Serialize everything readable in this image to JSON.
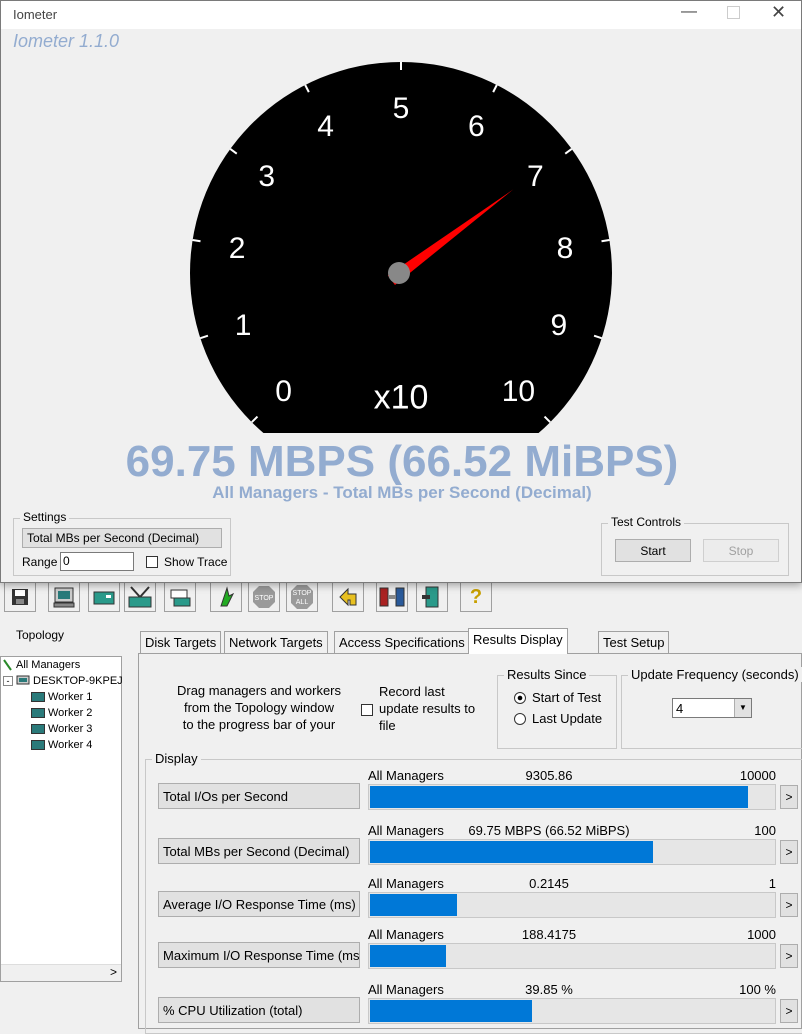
{
  "meter": {
    "window_title": "Iometer",
    "watermark": "Iometer 1.1.0",
    "gauge_labels": [
      "0",
      "1",
      "2",
      "3",
      "4",
      "5",
      "6",
      "7",
      "8",
      "9",
      "10"
    ],
    "gauge_multiplier": "x10",
    "needle_value": 6.975,
    "readout": "69.75 MBPS (66.52 MiBPS)",
    "subtitle": "All Managers - Total MBs per Second (Decimal)",
    "settings": {
      "label": "Settings",
      "metric_button": "Total MBs per Second (Decimal)",
      "range_label": "Range",
      "range_value": "0",
      "show_trace_label": "Show Trace"
    },
    "test_controls": {
      "label": "Test Controls",
      "start": "Start",
      "stop": "Stop"
    },
    "colors": {
      "gauge": "#000000",
      "needle": "#ff0000",
      "readout": "#93acd0"
    }
  },
  "topology": {
    "title": "Topology",
    "items": [
      {
        "label": "All Managers"
      },
      {
        "label": "DESKTOP-9KPEJ"
      },
      {
        "label": "Worker 1"
      },
      {
        "label": "Worker 2"
      },
      {
        "label": "Worker 3"
      },
      {
        "label": "Worker 4"
      }
    ],
    "scroll_left": "<",
    "scroll_right": ">"
  },
  "tabs": [
    "Disk Targets",
    "Network Targets",
    "Access Specifications",
    "Results Display",
    "Test Setup"
  ],
  "results": {
    "drag_text_1": "Drag managers and workers",
    "drag_text_2": "from the Topology window",
    "drag_text_3": "to the progress bar of your",
    "record_label_1": "Record last",
    "record_label_2": "update results to",
    "record_label_3": "file",
    "results_since": {
      "label": "Results Since",
      "option1": "Start of Test",
      "option2": "Last Update"
    },
    "update_frequency": {
      "label": "Update Frequency (seconds)",
      "value": "4"
    },
    "display_label": "Display",
    "rows": [
      {
        "button": "Total I/Os per Second",
        "manager": "All Managers",
        "value": "9305.86",
        "max": "10000",
        "fraction": 0.93
      },
      {
        "button": "Total MBs per Second (Decimal)",
        "manager": "All Managers",
        "value": "69.75 MBPS (66.52 MiBPS)",
        "max": "100",
        "fraction": 0.6975
      },
      {
        "button": "Average I/O Response Time (ms)",
        "manager": "All Managers",
        "value": "0.2145",
        "max": "1",
        "fraction": 0.2145
      },
      {
        "button": "Maximum I/O Response Time (ms",
        "manager": "All Managers",
        "value": "188.4175",
        "max": "1000",
        "fraction": 0.188
      },
      {
        "button": "% CPU Utilization (total)",
        "manager": "All Managers",
        "value": "39.85 %",
        "max": "100 %",
        "fraction": 0.3985
      }
    ],
    "arrow": ">"
  },
  "toolbar": {
    "stop_label": "STOP",
    "stop_all_label_1": "STOP",
    "stop_all_label_2": "ALL",
    "help_label": "?"
  }
}
